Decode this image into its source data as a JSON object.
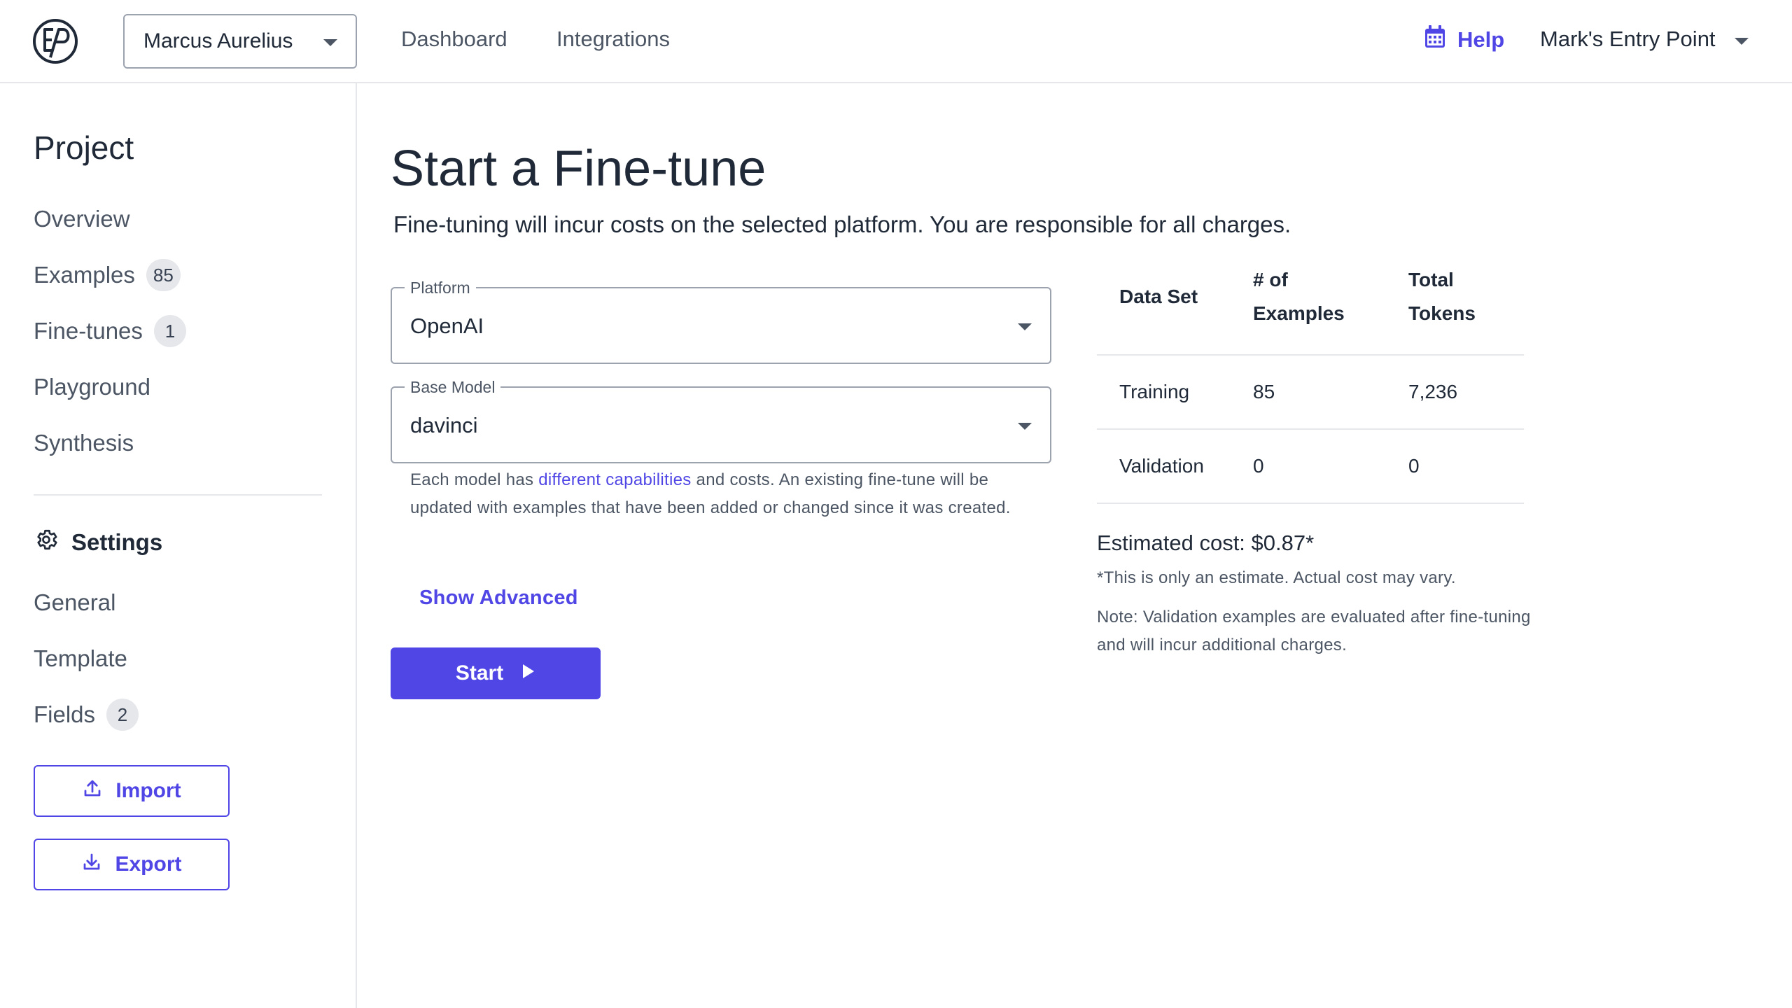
{
  "header": {
    "project_name": "Marcus Aurelius",
    "nav": [
      "Dashboard",
      "Integrations"
    ],
    "help_label": "Help",
    "user_name": "Mark's Entry Point"
  },
  "sidebar": {
    "heading": "Project",
    "items": [
      {
        "label": "Overview"
      },
      {
        "label": "Examples",
        "count": "85"
      },
      {
        "label": "Fine-tunes",
        "count": "1"
      },
      {
        "label": "Playground"
      },
      {
        "label": "Synthesis"
      }
    ],
    "settings_heading": "Settings",
    "settings_items": [
      {
        "label": "General"
      },
      {
        "label": "Template"
      },
      {
        "label": "Fields",
        "count": "2"
      }
    ],
    "import_label": "Import",
    "export_label": "Export"
  },
  "main": {
    "title": "Start a Fine-tune",
    "subtitle": "Fine-tuning will incur costs on the selected platform. You are responsible for all charges.",
    "platform": {
      "label": "Platform",
      "value": "OpenAI"
    },
    "base_model": {
      "label": "Base Model",
      "value": "davinci"
    },
    "helper_pre": "Each model has ",
    "helper_link": "different capabilities",
    "helper_post": " and costs. An existing fine-tune will be updated with examples that have been added or changed since it was created.",
    "show_advanced": "Show Advanced",
    "start_label": "Start"
  },
  "summary": {
    "columns": [
      "Data Set",
      "# of Examples",
      "Total Tokens"
    ],
    "rows": [
      {
        "dataset": "Training",
        "examples": "85",
        "tokens": "7,236"
      },
      {
        "dataset": "Validation",
        "examples": "0",
        "tokens": "0"
      }
    ],
    "estimated_cost": "Estimated cost: $0.87*",
    "estimate_note": "*This is only an estimate. Actual cost may vary.",
    "validation_note": "Note: Validation examples are evaluated after fine-tuning and will incur additional charges."
  },
  "colors": {
    "accent": "#4f46e5",
    "text": "#1f2937",
    "muted": "#4b5563",
    "border": "#e5e7eb"
  }
}
